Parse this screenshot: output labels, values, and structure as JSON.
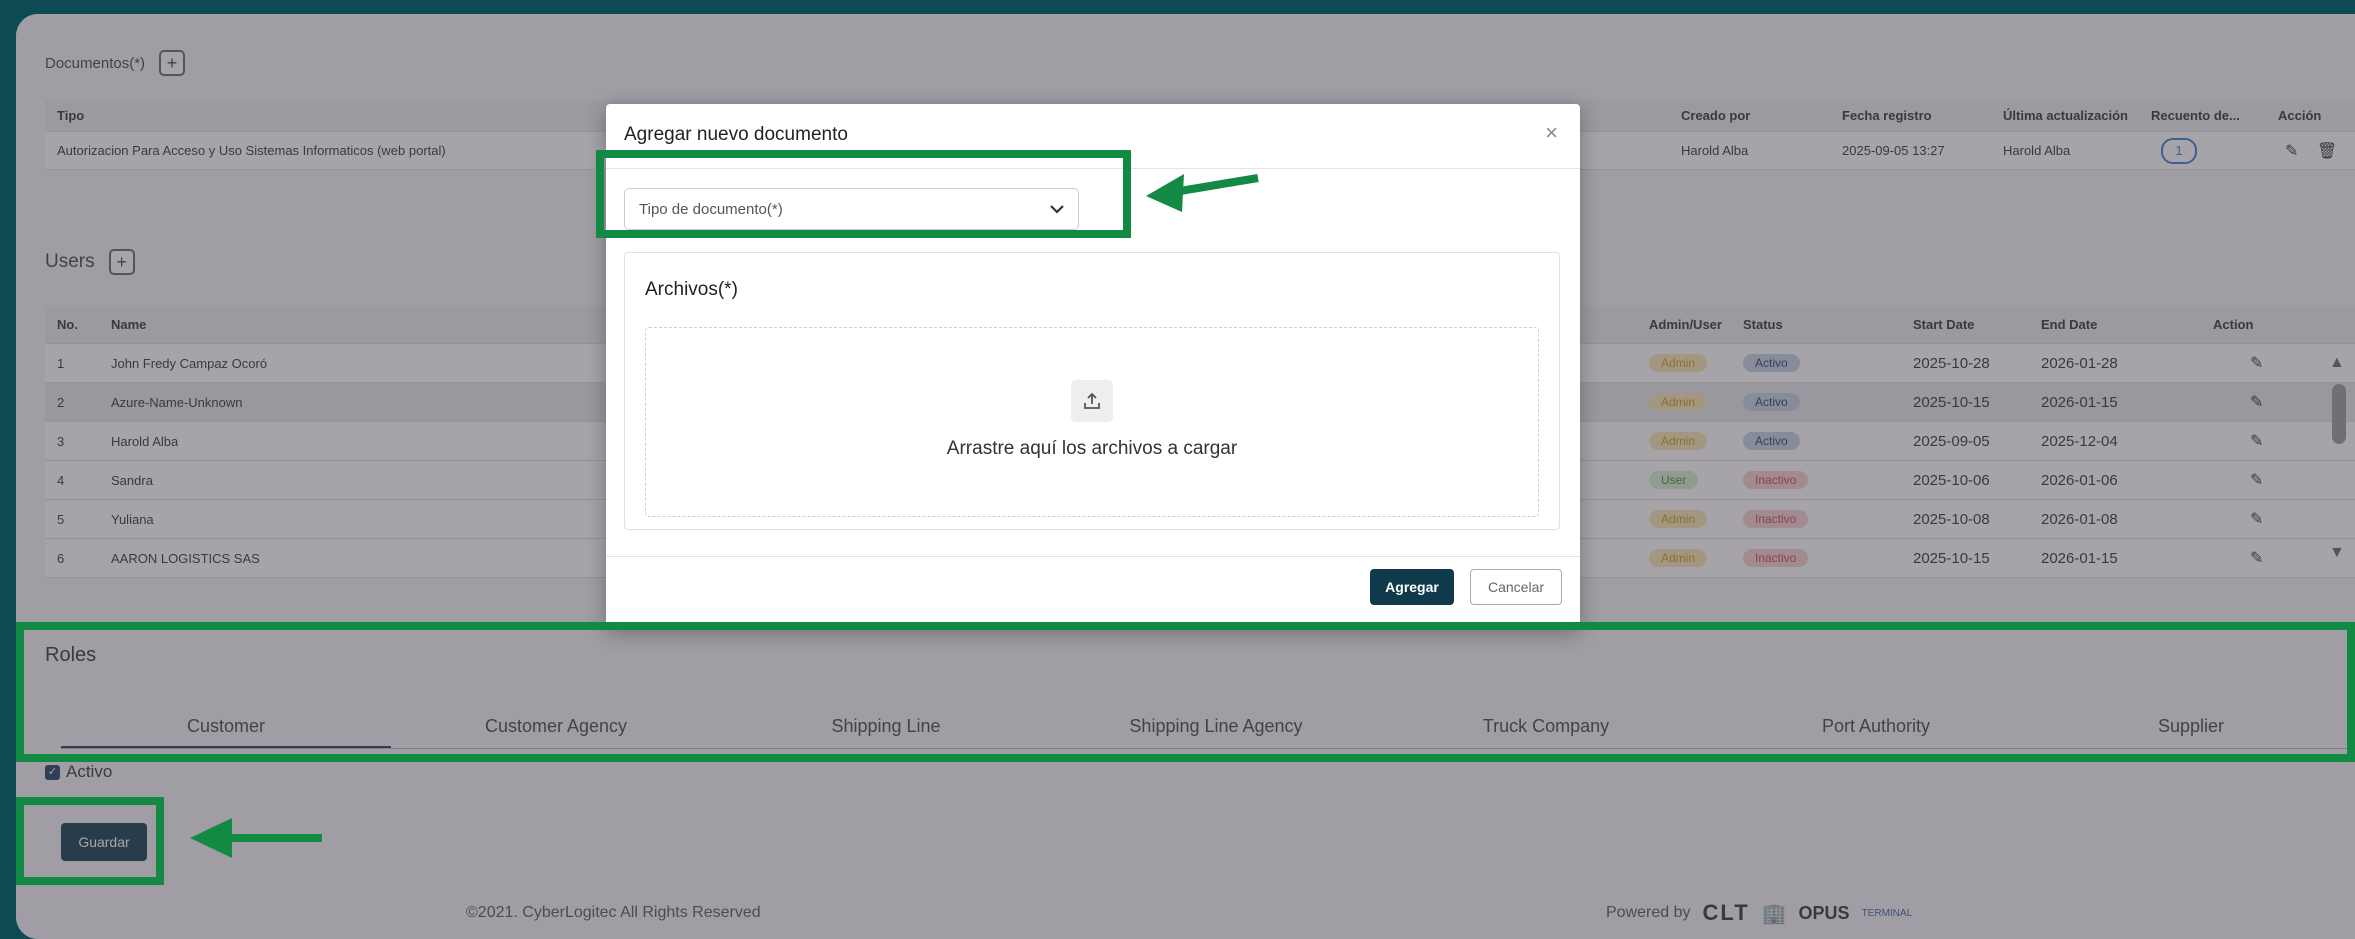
{
  "documents": {
    "title": "Documentos(*)",
    "add_label": "+",
    "headers": [
      "Tipo",
      "Creado por",
      "Fecha registro",
      "Última actualización",
      "Recuento de...",
      "Acción"
    ],
    "row": {
      "tipo": "Autorizacion Para Acceso y Uso Sistemas Informaticos (web portal)",
      "creado_por": "Harold Alba",
      "fecha_registro": "2025-09-05 13:27",
      "ultima_actualizacion": "Harold Alba",
      "recuento": "1"
    }
  },
  "users": {
    "title": "Users",
    "add_label": "+",
    "headers": {
      "no": "No.",
      "name": "Name",
      "admin_user": "Admin/User",
      "status": "Status",
      "start_date": "Start Date",
      "end_date": "End Date",
      "action": "Action"
    },
    "rows": [
      {
        "no": "1",
        "name": "John Fredy Campaz Ocoró",
        "role": "Admin",
        "status": "Activo",
        "start": "2025-10-28",
        "end": "2026-01-28"
      },
      {
        "no": "2",
        "name": "Azure-Name-Unknown",
        "role": "Admin",
        "status": "Activo",
        "start": "2025-10-15",
        "end": "2026-01-15"
      },
      {
        "no": "3",
        "name": "Harold Alba",
        "role": "Admin",
        "status": "Activo",
        "start": "2025-09-05",
        "end": "2025-12-04"
      },
      {
        "no": "4",
        "name": "Sandra",
        "role": "User",
        "status": "Inactivo",
        "start": "2025-10-06",
        "end": "2026-01-06"
      },
      {
        "no": "5",
        "name": "Yuliana",
        "role": "Admin",
        "status": "Inactivo",
        "start": "2025-10-08",
        "end": "2026-01-08"
      },
      {
        "no": "6",
        "name": "AARON LOGISTICS SAS",
        "role": "Admin",
        "status": "Inactivo",
        "start": "2025-10-15",
        "end": "2026-01-15"
      }
    ]
  },
  "roles": {
    "title": "Roles",
    "tabs": [
      "Customer",
      "Customer Agency",
      "Shipping Line",
      "Shipping Line Agency",
      "Truck Company",
      "Port Authority",
      "Supplier"
    ]
  },
  "activo_label": "Activo",
  "save_label": "Guardar",
  "footer": {
    "copyright": "©2021. CyberLogitec All Rights Reserved",
    "powered_by": "Powered by",
    "logo_clt": "CLT",
    "logo_opus": "OPUS",
    "logo_terminal": "TERMINAL"
  },
  "modal": {
    "title": "Agregar nuevo documento",
    "close": "×",
    "select_placeholder": "Tipo de documento(*)",
    "files_title": "Archivos(*)",
    "drop_text": "Arrastre aquí los archivos a cargar",
    "submit": "Agregar",
    "cancel": "Cancelar"
  },
  "colors": {
    "highlight": "#138a44",
    "primary": "#0f3a4c"
  }
}
